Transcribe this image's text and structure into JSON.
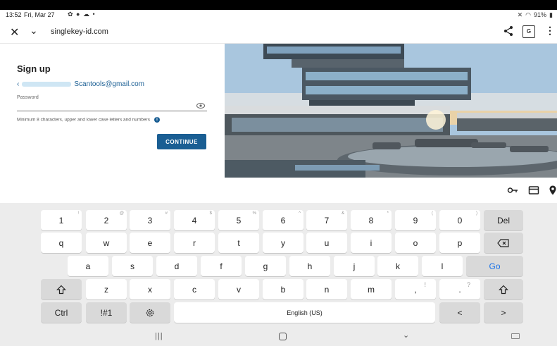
{
  "status_bar": {
    "time": "13:52",
    "date": "Fri, Mar 27",
    "left_icons": "✿ ● ☁ •",
    "battery": "91%"
  },
  "address_bar": {
    "url": "singlekey-id.com"
  },
  "signup": {
    "title": "Sign up",
    "email": "Scantools@gmail.com",
    "password_label": "Password",
    "password_value": "",
    "hint": "Minimum 8 characters, upper and lower case letters and numbers",
    "continue_label": "CONTINUE"
  },
  "keyboard": {
    "row1": [
      {
        "main": "1",
        "sub": "!"
      },
      {
        "main": "2",
        "sub": "@"
      },
      {
        "main": "3",
        "sub": "#"
      },
      {
        "main": "4",
        "sub": "$"
      },
      {
        "main": "5",
        "sub": "%"
      },
      {
        "main": "6",
        "sub": "^"
      },
      {
        "main": "7",
        "sub": "&"
      },
      {
        "main": "8",
        "sub": "*"
      },
      {
        "main": "9",
        "sub": "("
      },
      {
        "main": "0",
        "sub": ")"
      }
    ],
    "del_label": "Del",
    "row2": [
      "q",
      "w",
      "e",
      "r",
      "t",
      "y",
      "u",
      "i",
      "o",
      "p"
    ],
    "row3": [
      "a",
      "s",
      "d",
      "f",
      "g",
      "h",
      "j",
      "k",
      "l"
    ],
    "go_label": "Go",
    "row4": [
      "z",
      "x",
      "c",
      "v",
      "b",
      "n",
      "m"
    ],
    "comma_main": ",",
    "comma_sub": "!",
    "period_main": ".",
    "period_sub": "?",
    "ctrl_label": "Ctrl",
    "sym_label": "!#1",
    "space_label": "English (US)",
    "left_arrow": "<",
    "right_arrow": ">"
  },
  "colors": {
    "brand_blue": "#1a5e93",
    "go_blue": "#1a73e8"
  }
}
